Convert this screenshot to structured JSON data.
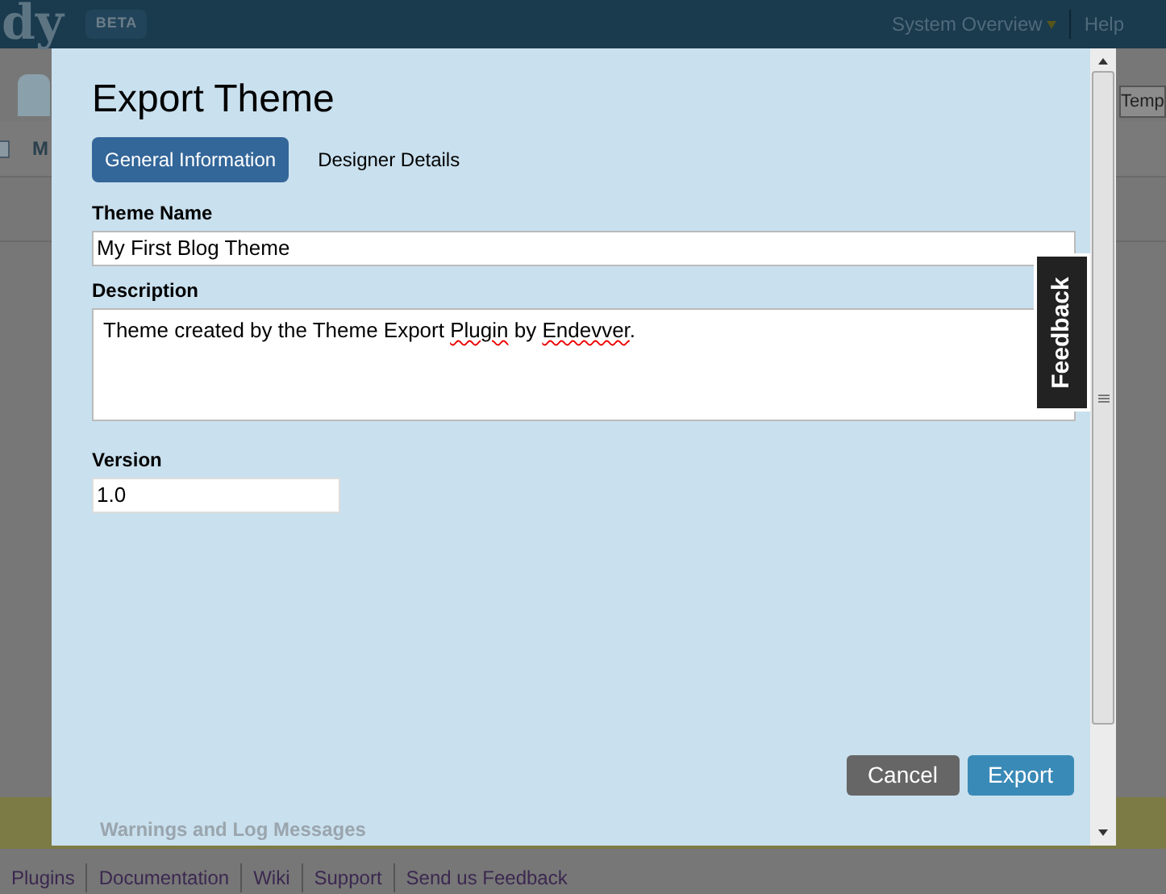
{
  "background": {
    "logo": "dy",
    "badge": "BETA",
    "nav": [
      "System Overview",
      "Help"
    ],
    "column_fragment": "M",
    "right_tab_fragment": "Temp",
    "footer_links": [
      "Plugins",
      "Documentation",
      "Wiki",
      "Support",
      "Send us Feedback"
    ]
  },
  "dialog": {
    "title": "Export Theme",
    "tabs": [
      {
        "label": "General Information",
        "selected": true
      },
      {
        "label": "Designer Details",
        "selected": false
      }
    ],
    "fields": [
      {
        "kind": "text",
        "label": "Theme Name",
        "value": "My First Blog Theme"
      },
      {
        "kind": "textarea",
        "label": "Description",
        "value": [
          {
            "text": "Theme created by the Theme Export ",
            "misspelled": false
          },
          {
            "text": "Plugin",
            "misspelled": true
          },
          {
            "text": " by ",
            "misspelled": false
          },
          {
            "text": "Endevver",
            "misspelled": true
          },
          {
            "text": ".",
            "misspelled": false
          }
        ]
      },
      {
        "kind": "short",
        "label": "Version",
        "value": "1.0"
      }
    ],
    "buttons": [
      {
        "label": "Cancel",
        "kind": "secondary"
      },
      {
        "label": "Export",
        "kind": "primary"
      }
    ],
    "section": "Warnings and Log Messages"
  },
  "feedback_tab": "Feedback"
}
